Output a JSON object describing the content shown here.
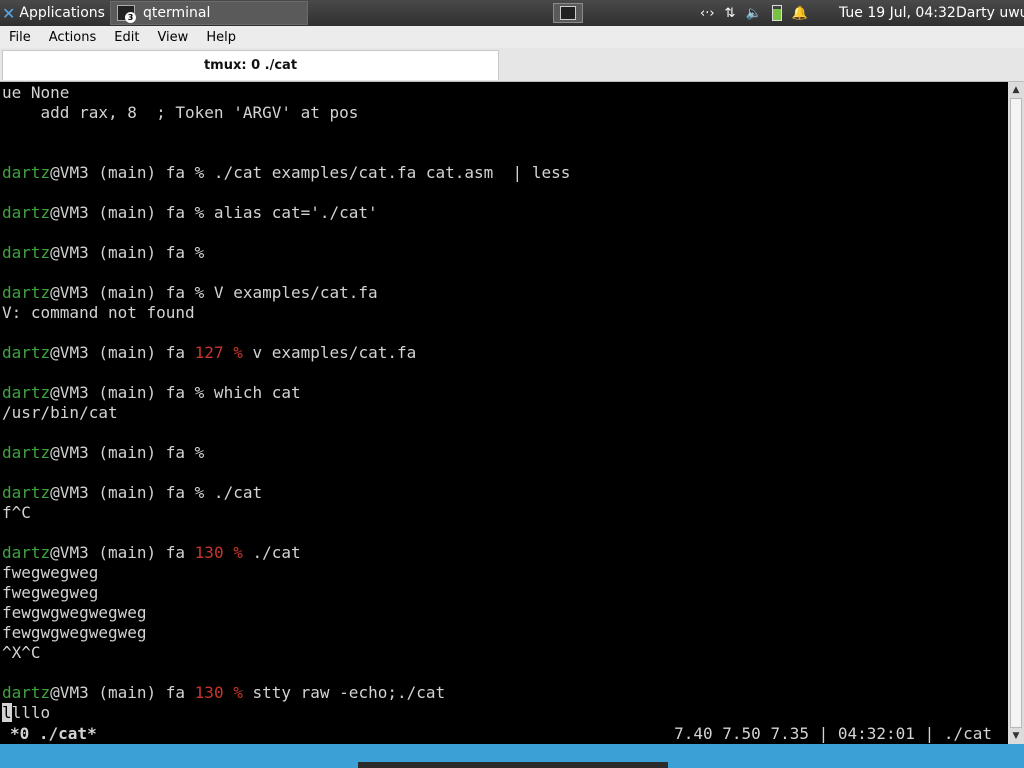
{
  "panel": {
    "apps_label": "Applications",
    "task_label": "qterminal",
    "task_badge": "3",
    "clock": "Tue 19 Jul, 04:32",
    "user": "Darty uwu",
    "tray_icons": [
      "network-icon",
      "transfer-icon",
      "volume-icon",
      "battery-icon",
      "bell-icon"
    ]
  },
  "menu": {
    "file": "File",
    "actions": "Actions",
    "edit": "Edit",
    "view": "View",
    "help": "Help"
  },
  "tab": {
    "title": "tmux: 0 ./cat"
  },
  "terminal": {
    "lines": [
      [
        {
          "t": "ue None"
        }
      ],
      [
        {
          "t": "    add rax, 8  ; Token 'ARGV' at pos"
        }
      ],
      [
        {
          "t": ""
        }
      ],
      [
        {
          "t": ""
        }
      ],
      [
        {
          "t": "dartz",
          "c": "usr"
        },
        {
          "t": "@VM3 (main) fa % ./cat examples/cat.fa cat.asm  | less"
        }
      ],
      [
        {
          "t": ""
        }
      ],
      [
        {
          "t": "dartz",
          "c": "usr"
        },
        {
          "t": "@VM3 (main) fa % alias cat='./cat'"
        }
      ],
      [
        {
          "t": ""
        }
      ],
      [
        {
          "t": "dartz",
          "c": "usr"
        },
        {
          "t": "@VM3 (main) fa %"
        }
      ],
      [
        {
          "t": ""
        }
      ],
      [
        {
          "t": "dartz",
          "c": "usr"
        },
        {
          "t": "@VM3 (main) fa % V examples/cat.fa"
        }
      ],
      [
        {
          "t": "V: command not found"
        }
      ],
      [
        {
          "t": ""
        }
      ],
      [
        {
          "t": "dartz",
          "c": "usr"
        },
        {
          "t": "@VM3 (main) fa "
        },
        {
          "t": "127 %",
          "c": "err"
        },
        {
          "t": " v examples/cat.fa"
        }
      ],
      [
        {
          "t": ""
        }
      ],
      [
        {
          "t": "dartz",
          "c": "usr"
        },
        {
          "t": "@VM3 (main) fa % which cat"
        }
      ],
      [
        {
          "t": "/usr/bin/cat"
        }
      ],
      [
        {
          "t": ""
        }
      ],
      [
        {
          "t": "dartz",
          "c": "usr"
        },
        {
          "t": "@VM3 (main) fa %"
        }
      ],
      [
        {
          "t": ""
        }
      ],
      [
        {
          "t": "dartz",
          "c": "usr"
        },
        {
          "t": "@VM3 (main) fa % ./cat"
        }
      ],
      [
        {
          "t": "f^C"
        }
      ],
      [
        {
          "t": ""
        }
      ],
      [
        {
          "t": "dartz",
          "c": "usr"
        },
        {
          "t": "@VM3 (main) fa "
        },
        {
          "t": "130 %",
          "c": "err"
        },
        {
          "t": " ./cat"
        }
      ],
      [
        {
          "t": "fwegwegweg"
        }
      ],
      [
        {
          "t": "fwegwegweg"
        }
      ],
      [
        {
          "t": "fewgwgwegwegweg"
        }
      ],
      [
        {
          "t": "fewgwgwegwegweg"
        }
      ],
      [
        {
          "t": "^X^C"
        }
      ],
      [
        {
          "t": ""
        }
      ],
      [
        {
          "t": "dartz",
          "c": "usr"
        },
        {
          "t": "@VM3 (main) fa "
        },
        {
          "t": "130 %",
          "c": "err"
        },
        {
          "t": " stty raw -echo;./cat"
        }
      ],
      [
        {
          "t": "l",
          "c": "cur"
        },
        {
          "t": "lllo"
        }
      ]
    ],
    "status_left": "*0 ./cat*",
    "status_right": "7.40 7.50 7.35 | 04:32:01 | ./cat"
  },
  "colors": {
    "prompt_user": "#3fa33f",
    "error_code": "#c8352d",
    "terminal_bg": "#000000",
    "terminal_fg": "#d3d3d3",
    "desktop_bg": "#3ba0d6"
  }
}
